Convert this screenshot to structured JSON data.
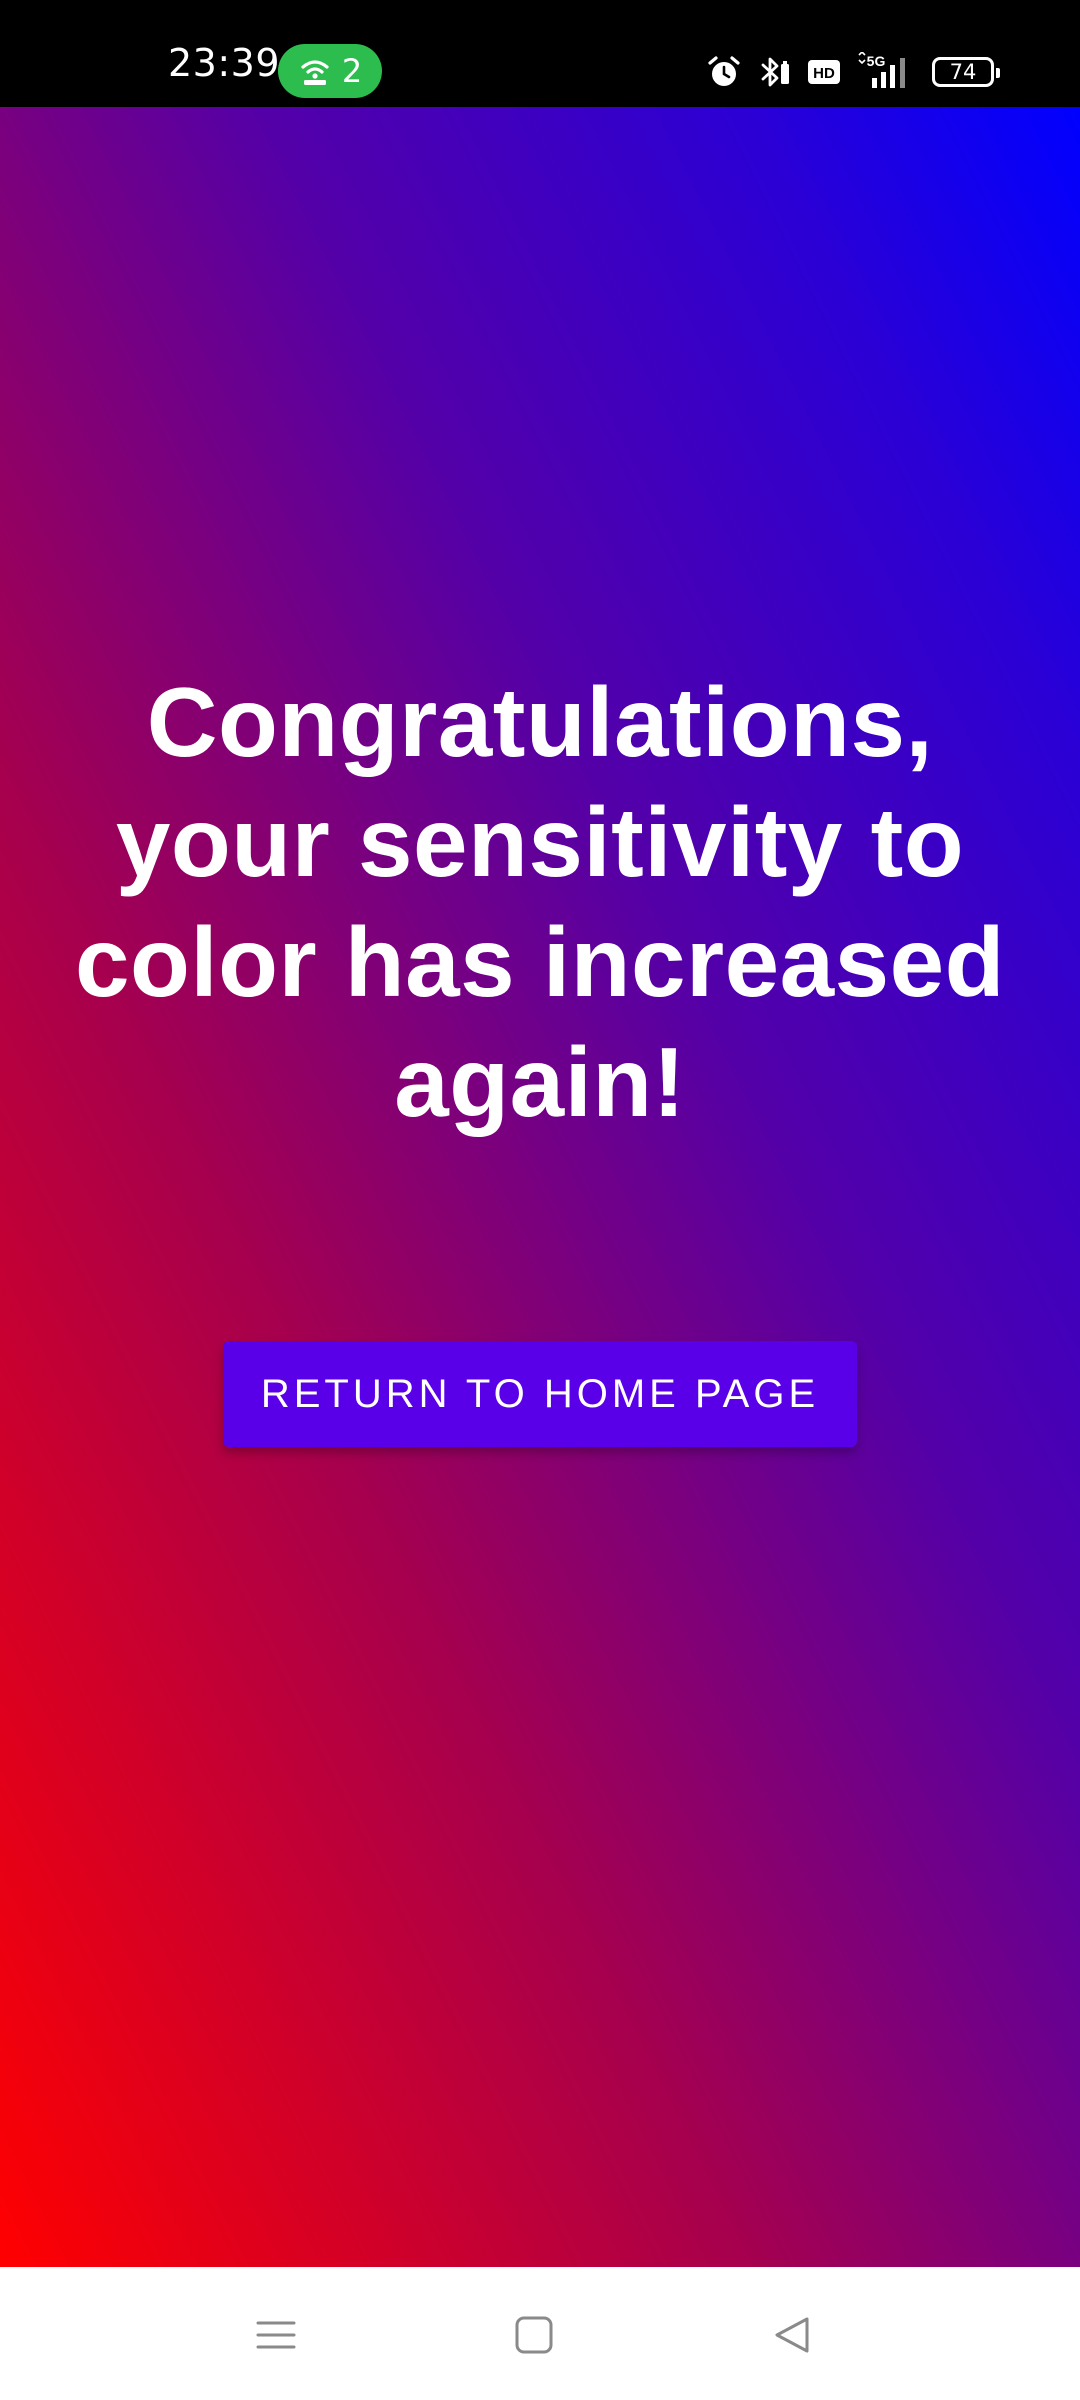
{
  "status_bar": {
    "time": "23:39",
    "hotspot_count": "2",
    "battery_level": "74",
    "icons": [
      "hotspot-icon",
      "alarm-icon",
      "bluetooth-icon",
      "hd-icon",
      "signal-5g-icon",
      "battery-icon"
    ],
    "hotspot_color": "#2dbd4e"
  },
  "main": {
    "message": "Congratulations, your sensitivity to color has increased again!",
    "button_label": "RETURN TO HOME PAGE",
    "button_color": "#5a00e8",
    "gradient_colors": [
      "#ff0000",
      "#a5004f",
      "#5400a8",
      "#0000ff"
    ]
  },
  "nav_bar": {
    "buttons": [
      "menu-icon",
      "home-icon",
      "back-icon"
    ]
  }
}
